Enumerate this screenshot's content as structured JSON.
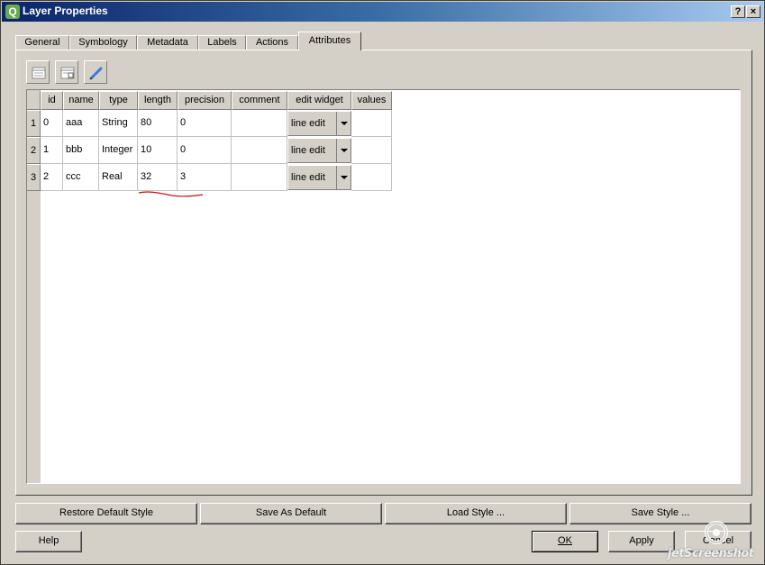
{
  "window": {
    "title": "Layer Properties",
    "app_icon_letter": "Q"
  },
  "titlebar_buttons": {
    "help": "?",
    "close": "×"
  },
  "tabs": [
    {
      "label": "General"
    },
    {
      "label": "Symbology"
    },
    {
      "label": "Metadata"
    },
    {
      "label": "Labels"
    },
    {
      "label": "Actions"
    },
    {
      "label": "Attributes",
      "active": true
    }
  ],
  "toolbar": {
    "icons": [
      "new-column-icon",
      "delete-column-icon",
      "toggle-editing-icon"
    ]
  },
  "table": {
    "columns": [
      "id",
      "name",
      "type",
      "length",
      "precision",
      "comment",
      "edit widget",
      "values"
    ],
    "rows": [
      {
        "num": "1",
        "id": "0",
        "name": "aaa",
        "type": "String",
        "length": "80",
        "precision": "0",
        "comment": "",
        "edit_widget": "line edit",
        "values": ""
      },
      {
        "num": "2",
        "id": "1",
        "name": "bbb",
        "type": "Integer",
        "length": "10",
        "precision": "0",
        "comment": "",
        "edit_widget": "line edit",
        "values": ""
      },
      {
        "num": "3",
        "id": "2",
        "name": "ccc",
        "type": "Real",
        "length": "32",
        "precision": "3",
        "comment": "",
        "edit_widget": "line edit",
        "values": ""
      }
    ]
  },
  "style_buttons": {
    "restore_default": "Restore Default Style",
    "save_as_default": "Save As Default",
    "load_style": "Load Style ...",
    "save_style": "Save Style ..."
  },
  "dialog_buttons": {
    "help": "Help",
    "ok": "OK",
    "apply": "Apply",
    "cancel": "Cancel"
  },
  "watermark": {
    "text": "jetScreenshot"
  },
  "colors": {
    "titlebar_start": "#0a246a",
    "titlebar_end": "#a6caf0",
    "dialog_bg": "#d4d0c8",
    "annotation_red": "#d01010"
  }
}
